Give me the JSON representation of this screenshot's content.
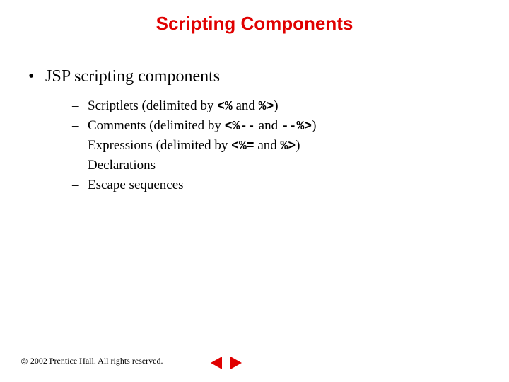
{
  "title": "Scripting Components",
  "bullet": {
    "marker": "•",
    "text": "JSP scripting components"
  },
  "sub": {
    "dash": "–",
    "items": [
      {
        "pre": "Scriptlets (delimited by ",
        "code1": "<%",
        "mid": " and ",
        "code2": "%>",
        "post": ")"
      },
      {
        "pre": "Comments (delimited by ",
        "code1": "<%--",
        "mid": " and ",
        "code2": "--%>",
        "post": ")"
      },
      {
        "pre": "Expressions (delimited by ",
        "code1": "<%=",
        "mid": " and ",
        "code2": "%>",
        "post": ")"
      },
      {
        "pre": "Declarations",
        "code1": "",
        "mid": "",
        "code2": "",
        "post": ""
      },
      {
        "pre": "Escape sequences",
        "code1": "",
        "mid": "",
        "code2": "",
        "post": ""
      }
    ]
  },
  "footer": {
    "symbol": "©",
    "text": "2002 Prentice Hall. All rights reserved."
  }
}
